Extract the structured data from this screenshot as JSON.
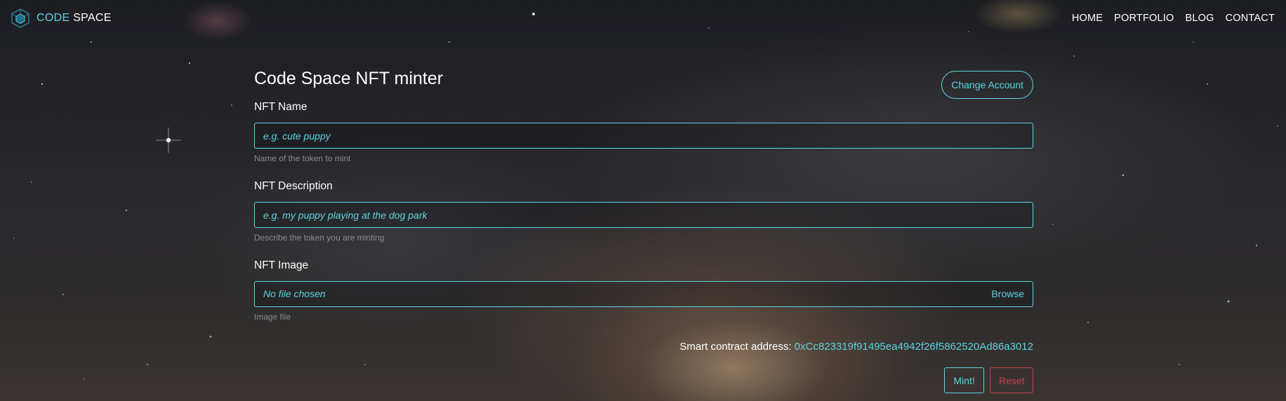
{
  "navbar": {
    "brand": {
      "code": "CODE",
      "space": "SPACE",
      "logo_icon": "cube-logo-icon"
    },
    "links": [
      "HOME",
      "PORTFOLIO",
      "BLOG",
      "CONTACT"
    ]
  },
  "form": {
    "title": "Code Space NFT minter",
    "change_account_label": "Change Account",
    "name": {
      "label": "NFT Name",
      "placeholder": "e.g. cute puppy",
      "help": "Name of the token to mint"
    },
    "description": {
      "label": "NFT Description",
      "placeholder": "e.g. my puppy playing at the dog park",
      "help": "Describe the token you are minting"
    },
    "image": {
      "label": "NFT Image",
      "status": "No file chosen",
      "browse_label": "Browse",
      "help": "Image file"
    },
    "contract": {
      "label": "Smart contract address:",
      "address": "0xCc823319f91495ea4942f26f5862520Ad86a3012"
    },
    "mint_label": "Mint!",
    "reset_label": "Reset"
  },
  "colors": {
    "accent": "#5fd3e0",
    "danger": "#c8414e",
    "muted_text": "#8a8c90"
  }
}
